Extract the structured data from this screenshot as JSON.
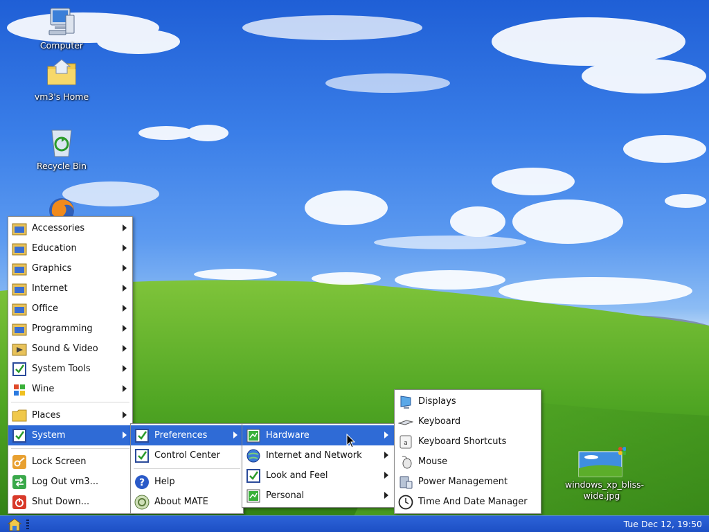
{
  "desktop": {
    "icons": [
      {
        "label": "Computer"
      },
      {
        "label": "vm3's Home"
      },
      {
        "label": "Recycle Bin"
      },
      {
        "label": "windows_xp_bliss-\nwide.jpg"
      }
    ]
  },
  "menus": {
    "main": {
      "items": [
        "Accessories",
        "Education",
        "Graphics",
        "Internet",
        "Office",
        "Programming",
        "Sound & Video",
        "System Tools",
        "Wine"
      ],
      "places": "Places",
      "system": "System",
      "actions": [
        "Lock Screen",
        "Log Out vm3...",
        "Shut Down..."
      ]
    },
    "system": {
      "items": [
        "Preferences",
        "Control Center"
      ],
      "extra": [
        "Help",
        "About MATE"
      ]
    },
    "preferences": {
      "items": [
        "Hardware",
        "Internet and Network",
        "Look and Feel",
        "Personal"
      ]
    },
    "hardware": {
      "items": [
        "Displays",
        "Keyboard",
        "Keyboard Shortcuts",
        "Mouse",
        "Power Management",
        "Time And Date Manager"
      ]
    }
  },
  "panel": {
    "clock": "Tue Dec 12, 19:50"
  },
  "colors": {
    "selection": "#2f6bd6",
    "panel": "#1d4fc4"
  }
}
